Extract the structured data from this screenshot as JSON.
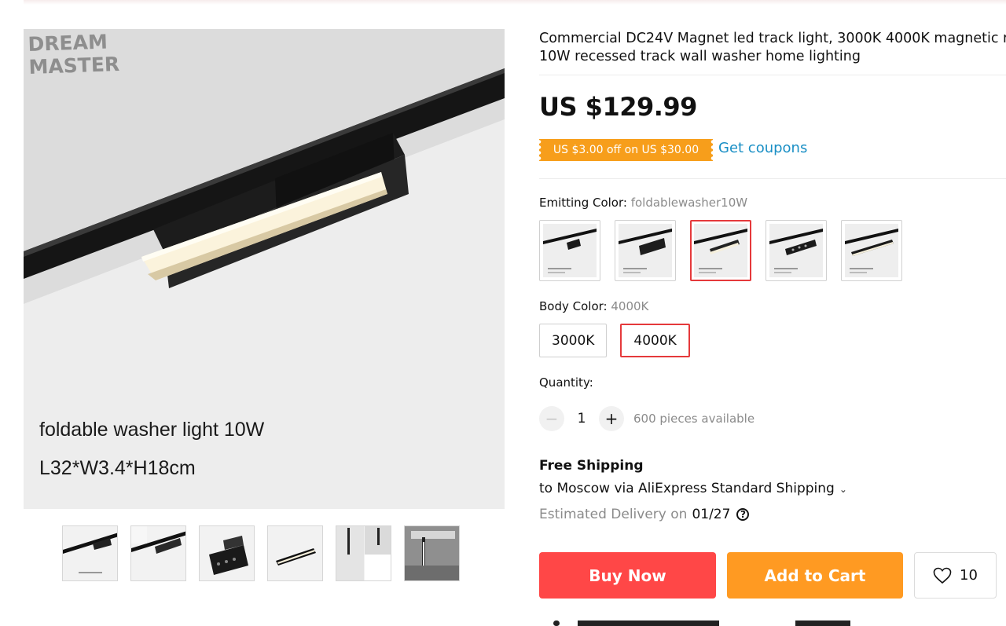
{
  "gallery": {
    "brand_logo": [
      "DREAM",
      "MASTER"
    ],
    "caption_line1": "foldable washer light 10W",
    "caption_line2": "L32*W3.4*H18cm",
    "thumbnails": [
      "thumb-1",
      "thumb-2",
      "thumb-3",
      "thumb-4",
      "thumb-5",
      "thumb-6"
    ]
  },
  "product": {
    "title_line1": "Commercial DC24V Magnet led track light, 3000K 4000K magnetic r",
    "title_line2": "10W recessed track wall washer home lighting",
    "price": "US $129.99"
  },
  "coupon": {
    "badge": "US $3.00 off on US $30.00",
    "link": "Get coupons",
    "badge_color": "#f79e1b",
    "link_color": "#1a8fc5"
  },
  "emitting_color": {
    "label": "Emitting Color:",
    "selected": "foldablewasher10W",
    "options_count": 5,
    "selected_index": 2
  },
  "body_color": {
    "label": "Body Color:",
    "selected": "4000K",
    "options": [
      "3000K",
      "4000K"
    ]
  },
  "quantity": {
    "label": "Quantity:",
    "minus": "−",
    "value": "1",
    "plus": "+",
    "available": "600 pieces available"
  },
  "shipping": {
    "title": "Free Shipping",
    "via": "to Moscow via AliExpress Standard Shipping",
    "chevron": "⌄",
    "estimated_label": "Estimated Delivery on",
    "date": "01/27",
    "help": "?"
  },
  "actions": {
    "buy_now": "Buy Now",
    "add_to_cart": "Add to Cart",
    "wishlist_count": "10",
    "buy_color": "#ff4747",
    "cart_color": "#ff9a22",
    "selected_border_color": "#e5393b"
  }
}
